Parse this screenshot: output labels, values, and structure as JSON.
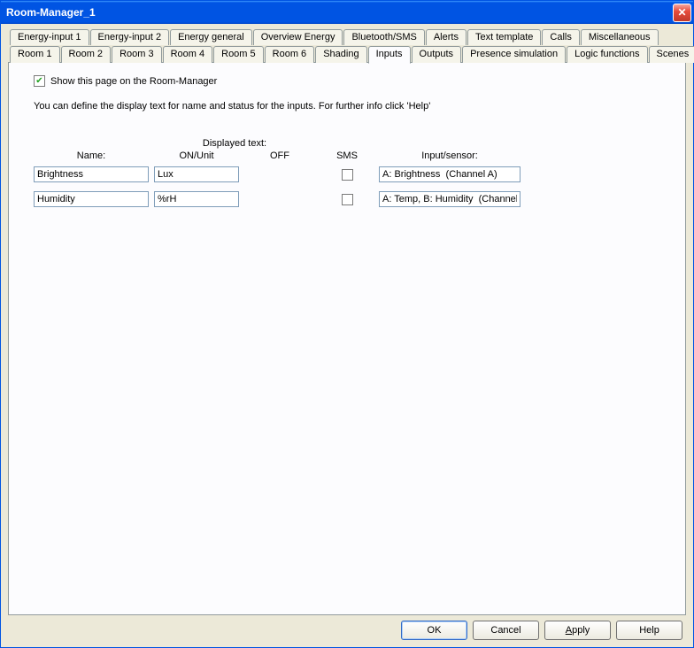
{
  "window": {
    "title": "Room-Manager_1"
  },
  "tabs_row1": [
    "Energy-input 1",
    "Energy-input 2",
    "Energy general",
    "Overview Energy",
    "Bluetooth/SMS",
    "Alerts",
    "Text template",
    "Calls",
    "Miscellaneous"
  ],
  "tabs_row2": [
    "Room 1",
    "Room 2",
    "Room 3",
    "Room 4",
    "Room 5",
    "Room 6",
    "Shading",
    "Inputs",
    "Outputs",
    "Presence simulation",
    "Logic functions",
    "Scenes"
  ],
  "active_tab": "Inputs",
  "checkbox": {
    "checked": true,
    "label": "Show this page on the Room-Manager"
  },
  "description": "You can define the display text for name and status for the inputs. For further info click 'Help'",
  "headers": {
    "displayed_text": "Displayed text:",
    "name": "Name:",
    "on_unit": "ON/Unit",
    "off": "OFF",
    "sms": "SMS",
    "input_sensor": "Input/sensor:"
  },
  "rows": [
    {
      "name": "Brightness",
      "on_unit": "Lux",
      "off": "",
      "sms": false,
      "sensor": "A: Brightness  (Channel A)"
    },
    {
      "name": "Humidity",
      "on_unit": "%rH",
      "off": "",
      "sms": false,
      "sensor": "A: Temp, B: Humidity  (Channel"
    }
  ],
  "buttons": {
    "ok": "OK",
    "cancel": "Cancel",
    "apply": "Apply",
    "help": "Help"
  }
}
